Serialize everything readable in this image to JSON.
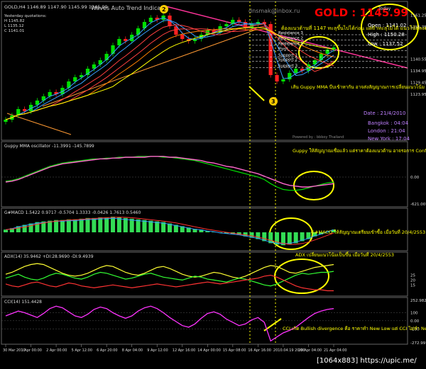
{
  "chart_data": [
    {
      "type": "line",
      "panel": "price",
      "symbol_line": "GOLD,H4   1146.89 1147.90 1145.99 1145.99",
      "indicator_title": "Waves Auto Trend Indicator",
      "contact": "dnsmak@inbox.ru",
      "info_lines": [
        "Yesterday quotations:",
        "H 1145.82",
        "L 1135.12",
        "C 1141.01"
      ],
      "gold_label": "GOLD : 1145.99",
      "today_label": "Today",
      "today_open": "Open : 1141.02",
      "today_high": "High : 1150.28",
      "today_low": "Low : 1137.52",
      "date_label": "Date : 21/4/2010",
      "times": [
        "Bangkok : 04:04",
        "London : 21:04",
        "New York : 17:04"
      ],
      "powered": "Powered by : bbboy Thailand",
      "levels": [
        "Resistance 3",
        "Resistance 2",
        "Resistance 1",
        "Pivot",
        "Support 1",
        "Support 2",
        "Support 3"
      ],
      "price_ticks": [
        "1161.25",
        "1155.75",
        "1145.99",
        "1140.55",
        "1134.95",
        "1129.45",
        "1123.95"
      ],
      "annotation_1": "ต้องแนวต้านที่ 1147 ทะลุขึ้นไปได้ก่อน แต่ถ้าทะลุไม่ได้ แนวโน้มลงต่อ",
      "annotation_2": "เส้น Guppy MMA บีบเข้าหากัน อาจส่งสัญญาณการเปลี่ยนแนวโน้ม",
      "badges": [
        "2",
        "3"
      ],
      "close": [
        1112,
        1114,
        1117,
        1116,
        1119,
        1121,
        1123,
        1125,
        1124,
        1127,
        1130,
        1132,
        1133,
        1136,
        1138,
        1140,
        1143,
        1147,
        1150,
        1149,
        1152,
        1155,
        1158,
        1160,
        1159,
        1161,
        1156,
        1152,
        1150,
        1149,
        1150,
        1152,
        1154,
        1153,
        1156,
        1157,
        1159,
        1158,
        1155,
        1157,
        1158,
        1157,
        1133,
        1130,
        1131,
        1134,
        1136,
        1135,
        1138,
        1140,
        1143,
        1145,
        1146
      ]
    },
    {
      "type": "line",
      "panel": "guppy",
      "title": "Guppy MMA oscillator -11.3991 -145.7899",
      "ticks": [
        "0.00",
        "-621.007"
      ],
      "annotation": "Guppy ให้สัญญาณเชื่อแล้ว แต่ราคาต้องแนวต้าน อาจรอการ Confirm ด้วยการ Breakout แนวต้านที่ 1147 ก่อน ถึงจะปลอดภัย",
      "series": [
        {
          "values": [
            -5,
            -4,
            -2,
            1,
            4,
            7,
            10,
            13,
            15,
            17,
            18,
            19,
            20,
            21,
            22,
            22,
            23,
            23,
            24,
            24,
            24,
            25,
            25,
            25,
            25,
            24,
            24,
            23,
            22,
            21,
            20,
            18,
            16,
            14,
            12,
            10,
            8,
            6,
            4,
            2,
            0,
            -3,
            -8,
            -12,
            -15,
            -16,
            -16,
            -15,
            -13,
            -11,
            -9,
            -7,
            -6
          ]
        },
        {
          "values": [
            -6,
            -5,
            -3,
            0,
            3,
            6,
            9,
            12,
            14,
            16,
            17,
            18,
            19,
            20,
            21,
            22,
            22,
            23,
            23,
            24,
            24,
            24,
            24,
            25,
            25,
            25,
            24,
            24,
            23,
            22,
            21,
            20,
            18,
            17,
            15,
            13,
            12,
            10,
            8,
            6,
            4,
            1,
            -2,
            -5,
            -8,
            -10,
            -11,
            -12,
            -12,
            -11,
            -10,
            -9,
            -8
          ]
        }
      ]
    },
    {
      "type": "bar",
      "panel": "gmacd",
      "title": "G#MACD 1.5422 0.9717 -0.5704 1.3333 -0.0426 1.7613 0.5460",
      "annotation": "G#MACD ให้สัญญาณเตรียมเข้าซื้อ เมื่อวันที่ 20/4/2553",
      "values": [
        0.4,
        0.6,
        0.9,
        1.1,
        1.3,
        1.5,
        1.6,
        1.7,
        1.8,
        1.8,
        1.9,
        1.9,
        2.0,
        2.1,
        2.1,
        2.2,
        2.2,
        2.3,
        2.2,
        2.1,
        2.0,
        1.9,
        1.8,
        1.7,
        1.6,
        1.5,
        1.3,
        1.1,
        0.9,
        0.7,
        0.5,
        0.4,
        0.2,
        0.1,
        -0.1,
        -0.2,
        -0.3,
        -0.4,
        -0.6,
        -0.8,
        -1.0,
        -1.3,
        -1.6,
        -1.8,
        -1.9,
        -1.8,
        -1.6,
        -1.3,
        -1.0,
        -0.6,
        -0.3,
        0.1,
        0.4
      ]
    },
    {
      "type": "line",
      "panel": "adx",
      "title": "ADX(14) 35.9462 +DI:28.9690 -DI:9.4939",
      "ticks": [
        "25",
        "20",
        "15"
      ],
      "annotation": "ADX เปลี่ยนแนวโน้มเป็นขึ้น เมื่อวันที่ 20/4/2553",
      "series": [
        {
          "values": [
            26,
            28,
            31,
            34,
            36,
            37,
            36,
            33,
            30,
            27,
            25,
            24,
            25,
            27,
            30,
            33,
            35,
            34,
            31,
            28,
            26,
            25,
            27,
            30,
            33,
            34,
            32,
            29,
            26,
            24,
            23,
            24,
            26,
            28,
            27,
            25,
            23,
            22,
            24,
            27,
            30,
            33,
            35,
            34,
            31,
            28,
            27,
            29,
            31,
            33,
            34,
            35,
            36
          ]
        },
        {
          "values": [
            22,
            24,
            26,
            23,
            21,
            20,
            22,
            25,
            27,
            26,
            24,
            22,
            21,
            23,
            26,
            28,
            27,
            25,
            23,
            21,
            22,
            24,
            26,
            27,
            25,
            23,
            22,
            21,
            20,
            22,
            24,
            23,
            21,
            20,
            19,
            18,
            20,
            22,
            21,
            19,
            17,
            15,
            14,
            16,
            19,
            22,
            25,
            27,
            26,
            27,
            28,
            28,
            29
          ]
        },
        {
          "values": [
            16,
            14,
            13,
            15,
            17,
            18,
            16,
            14,
            13,
            15,
            17,
            16,
            14,
            13,
            12,
            13,
            14,
            15,
            14,
            13,
            12,
            13,
            14,
            15,
            16,
            15,
            14,
            13,
            14,
            15,
            16,
            17,
            18,
            17,
            16,
            17,
            18,
            19,
            20,
            21,
            22,
            24,
            25,
            23,
            20,
            17,
            14,
            12,
            11,
            10,
            10,
            9,
            9
          ]
        }
      ]
    },
    {
      "type": "line",
      "panel": "cci",
      "title": "CCI(14) 151.4428",
      "ticks": [
        "252.982",
        "100",
        "0.00",
        "-100",
        "-272.991"
      ],
      "annotation": "CCI เกิด Bullish divergence คือ ราคาทำ New Low แต่ CCI ไม่ทำ New Low อย่างเห็นได้ชัด เมื่อวันที่ 19/4/2553",
      "values": [
        60,
        90,
        120,
        100,
        70,
        40,
        90,
        150,
        180,
        160,
        110,
        60,
        40,
        80,
        140,
        170,
        150,
        100,
        60,
        30,
        60,
        120,
        160,
        180,
        150,
        100,
        40,
        -10,
        -60,
        -80,
        -40,
        30,
        90,
        110,
        80,
        20,
        -20,
        -60,
        -40,
        10,
        40,
        -20,
        -250,
        -200,
        -150,
        -120,
        -80,
        -20,
        40,
        90,
        120,
        140,
        150
      ]
    }
  ],
  "x_axis": [
    "30 Mar 2010",
    "1 Apr 00:00",
    "2 Apr 00:00",
    "5 Apr 12:00",
    "6 Apr 20:00",
    "8 Apr 04:00",
    "9 Apr 12:00",
    "12 Apr 16:00",
    "14 Apr 00:00",
    "15 Apr 08:00",
    "16 Apr 16:00",
    "2010.04.19 20:00",
    "20 Apr 04:00",
    "21 Apr 04:00"
  ],
  "watermark": "[1064x883] https://upic.me/",
  "colors": {
    "up": "#00e000",
    "down": "#ff2020",
    "accent": "#ff0000",
    "note": "#ffff00",
    "cyan": "#00ffff",
    "magenta": "#ff00ff"
  }
}
